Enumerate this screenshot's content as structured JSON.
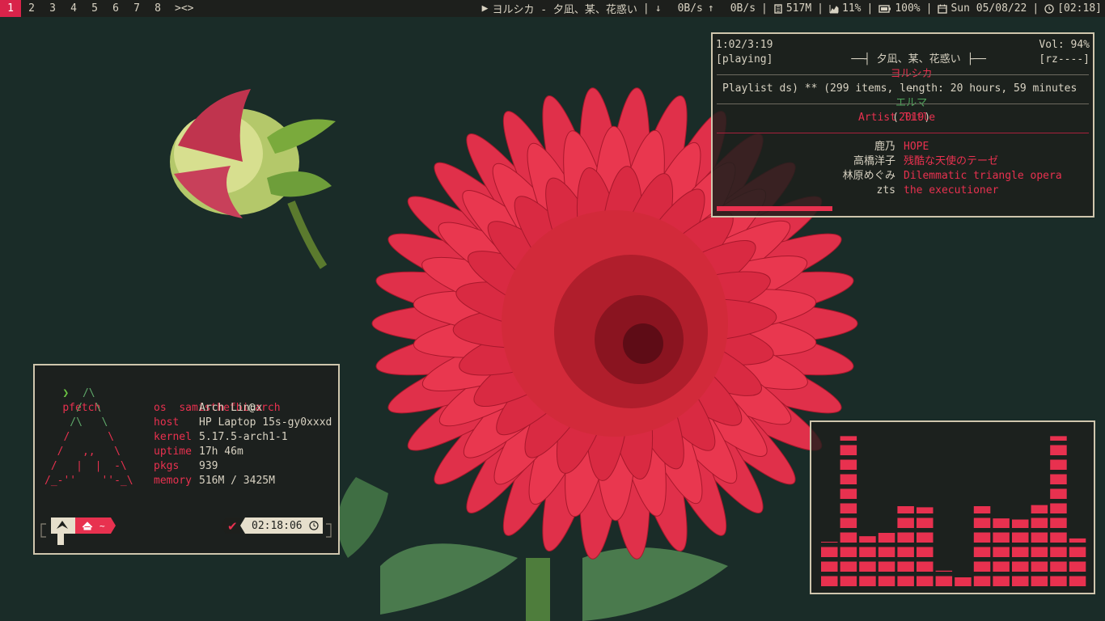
{
  "bar": {
    "workspaces": [
      {
        "label": "1",
        "active": true
      },
      {
        "label": "2",
        "active": false
      },
      {
        "label": "3",
        "active": false
      },
      {
        "label": "4",
        "active": false
      },
      {
        "label": "5",
        "active": false
      },
      {
        "label": "6",
        "active": false
      },
      {
        "label": "7",
        "active": false
      },
      {
        "label": "8",
        "active": false
      }
    ],
    "layout": "><>",
    "now_playing_icon": "play-icon",
    "now_playing": "ヨルシカ - 夕凪、某、花惑い",
    "net_down": "0B/s",
    "net_up": "0B/s",
    "memory": "517M",
    "cpu": "11%",
    "battery": "100%",
    "date": "Sun 05/08/22",
    "time": "[02:18]"
  },
  "ncmpcpp": {
    "elapsed": "1:02/3:19",
    "state": "[playing]",
    "song_title": "夕凪、某、花惑い",
    "artist": "ヨルシカ",
    "dash": "-",
    "album": "エルマ",
    "year": "2019",
    "volume": "Vol: 94%",
    "flags": "[rz----]",
    "playlist_info": "Playlist ds) ** (299 items, length: 20 hours, 59 minutes",
    "columns": {
      "artist": "Artist",
      "title": "Title"
    },
    "progress": 0.31,
    "rows": [
      {
        "artist": "鹿乃",
        "title": "HOPE"
      },
      {
        "artist": "高橋洋子",
        "title": "残酷な天使のテーゼ"
      },
      {
        "artist": "林原めぐみ",
        "title": "Dilemmatic triangle opera"
      },
      {
        "artist": "zts",
        "title": "the executioner"
      }
    ]
  },
  "terminal": {
    "prompt_char": "❯",
    "command": "pfetch",
    "user": "samisthefbi",
    "at": "@",
    "host_name": "arch",
    "info": [
      {
        "label": "os",
        "value": "Arch Linux"
      },
      {
        "label": "host",
        "value": "HP Laptop 15s-gy0xxxd"
      },
      {
        "label": "kernel",
        "value": "5.17.5-arch1-1"
      },
      {
        "label": "uptime",
        "value": "17h 46m"
      },
      {
        "label": "pkgs",
        "value": "939"
      },
      {
        "label": "memory",
        "value": "516M / 3425M"
      }
    ],
    "ascii": [
      {
        "text": "      /\\",
        "color": "green"
      },
      {
        "text": "     /  \\",
        "color": "green"
      },
      {
        "text": "    /\\   \\",
        "color": "green"
      },
      {
        "text": "   /      \\",
        "color": "red"
      },
      {
        "text": "  /   ,,   \\",
        "color": "red"
      },
      {
        "text": " /   |  |  -\\",
        "color": "red"
      },
      {
        "text": "/_-''    ''-_\\",
        "color": "red"
      }
    ],
    "status_check": "✔",
    "clock": "02:18:06",
    "home_symbol": "~"
  },
  "visualizer": {
    "levels": [
      0.28,
      0.95,
      0.33,
      0.36,
      0.52,
      0.51,
      0.1,
      0.08,
      0.52,
      0.45,
      0.44,
      0.53,
      0.95,
      0.31
    ]
  },
  "colors": {
    "accent": "#e8314f",
    "background": "#1a2c28",
    "panel": "#1d1f1c",
    "border": "#cfc6ad",
    "text": "#d8d2c2",
    "green": "#5fa86a"
  }
}
